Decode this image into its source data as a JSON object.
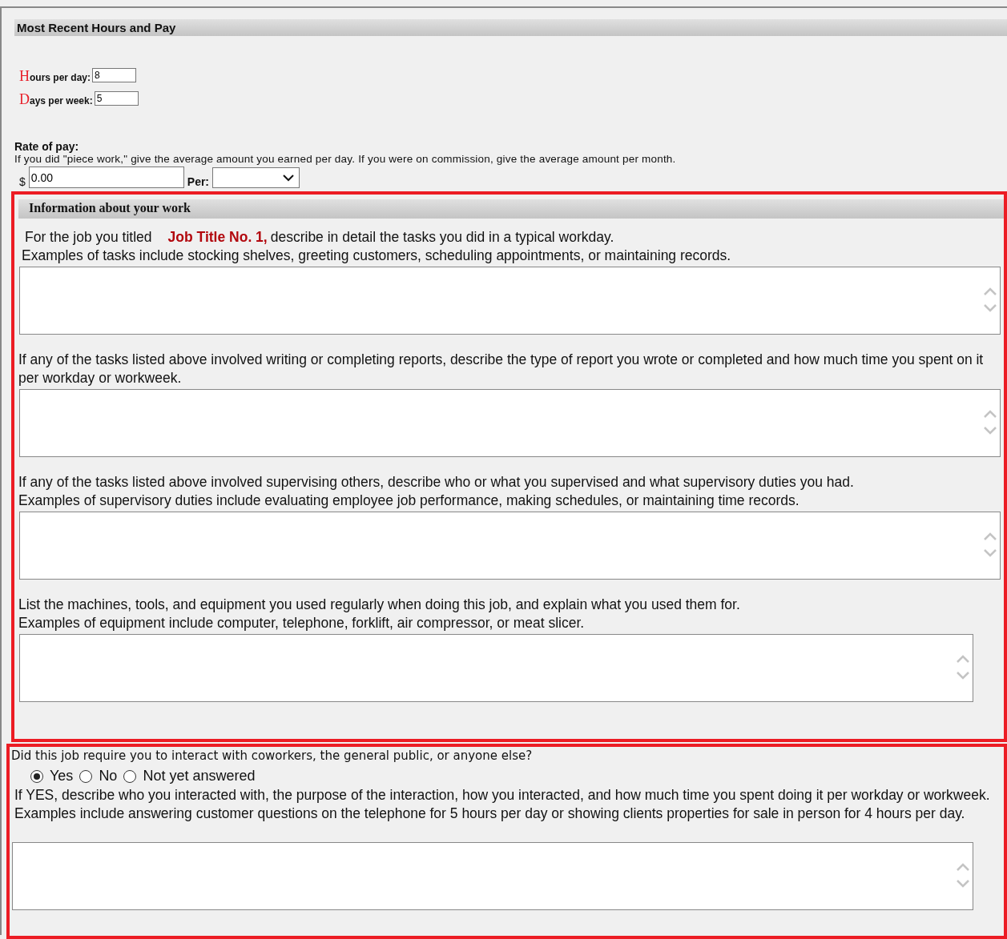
{
  "hours_and_pay": {
    "title": "Most Recent Hours and Pay",
    "fields": [
      {
        "label": "Hours per day:",
        "value": "8"
      },
      {
        "label": "Days per week:",
        "value": "5"
      }
    ],
    "rate": {
      "title": "Rate of pay:",
      "hint": "If you did \"piece work,\" give the average amount you earned per day. If you were on commission, give the average amount per month.",
      "currency": "$",
      "value": "0.00",
      "per_label": "Per:"
    }
  },
  "work_info": {
    "title": "Information about your work",
    "intro": {
      "before": "For the job you titled",
      "job_title": "Job Title No. 1,",
      "after": "describe in detail the tasks you did in a typical workday."
    },
    "questions": [
      {
        "lines": [
          "Examples of tasks include stocking shelves, greeting customers, scheduling appointments, or maintaining records."
        ]
      },
      {
        "lines": [
          "If any of the tasks listed above involved writing or completing reports, describe the type of report you wrote or completed and how much time you spent on it per workday or workweek."
        ]
      },
      {
        "lines": [
          "If any of the tasks listed above involved supervising others, describe who or what you supervised and what supervisory duties you had.",
          "Examples of supervisory duties include evaluating employee job performance, making schedules, or maintaining time records."
        ]
      },
      {
        "lines": [
          "List the machines, tools, and equipment you used regularly when doing this job, and explain what you used them for.",
          "Examples of equipment include computer, telephone, forklift, air compressor, or meat slicer."
        ]
      }
    ]
  },
  "interaction": {
    "question": "Did this job require you to interact with coworkers, the general public, or anyone else?",
    "options": [
      {
        "label": "Yes",
        "selected": true
      },
      {
        "label": "No",
        "selected": false
      },
      {
        "label": "Not yet answered",
        "selected": false
      }
    ],
    "description": "If YES, describe who you interacted with, the purpose of the interaction, how you interacted, and how much time you spent doing it per workday or workweek. Examples include answering customer questions on the telephone for 5 hours per day or showing clients properties for sale in person for 4 hours per day."
  }
}
